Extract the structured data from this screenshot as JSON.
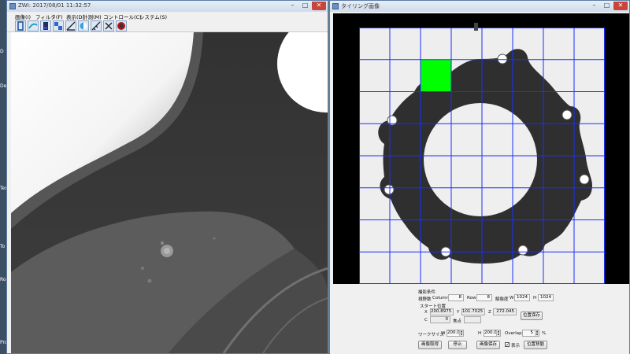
{
  "desktop": {
    "labels": [
      "D",
      "Del",
      "Tes",
      "To",
      "Rol",
      "Pro"
    ]
  },
  "left_window": {
    "title": "ZWI: 2017/08/01 11:32:57",
    "menu": [
      "画像(I)",
      "フィルタ(F)",
      "表示(D)",
      "計測(M)",
      "コントロール(C)",
      "システム(S)"
    ],
    "tools": [
      "frame-icon",
      "sweep-icon",
      "battery-icon",
      "halftone-icon",
      "scale-icon",
      "contrast-icon",
      "ruler-icon",
      "crosshair-icon",
      "stop-record-icon"
    ],
    "minimize": "–",
    "maximize": "□",
    "close": "✕"
  },
  "right_window": {
    "title": "タイリング画像",
    "minimize": "–",
    "maximize": "□",
    "close": "✕",
    "grid": {
      "columns": 8,
      "rows": 8,
      "highlight": {
        "column": 2,
        "row": 1,
        "color": "#00ff00"
      },
      "line_color": "#1a2fff"
    },
    "panel": {
      "section": "撮影条件",
      "fov_label": "視野数",
      "column_label": "Column",
      "column_value": "8",
      "row_label": "Row",
      "row_value": "8",
      "res_label": "解像度",
      "w_label": "W",
      "w_value": "1024",
      "h_label": "H",
      "h_value": "1024",
      "start_label": "スタート位置",
      "x_label": "X",
      "x_value": "200.8975",
      "y_label": "Y",
      "y_value": "101.7025",
      "z_label": "Z",
      "z_value": "272.045",
      "c_label": "C",
      "c_value": "0",
      "focus_label": "焦点",
      "save_pos": "位置保存",
      "work_size_label": "ワークサイズ",
      "ws_w_label": "W",
      "ws_w_value": "200.0",
      "ws_h_label": "H",
      "ws_h_value": "200.0",
      "overlap_label": "Overlap",
      "overlap_value": "5",
      "overlap_unit": "%",
      "acquire": "画像取得",
      "stop": "停止",
      "save_image": "画像保存",
      "show_label": "表示",
      "show_checked": "✓",
      "move_pos": "位置移動"
    }
  }
}
